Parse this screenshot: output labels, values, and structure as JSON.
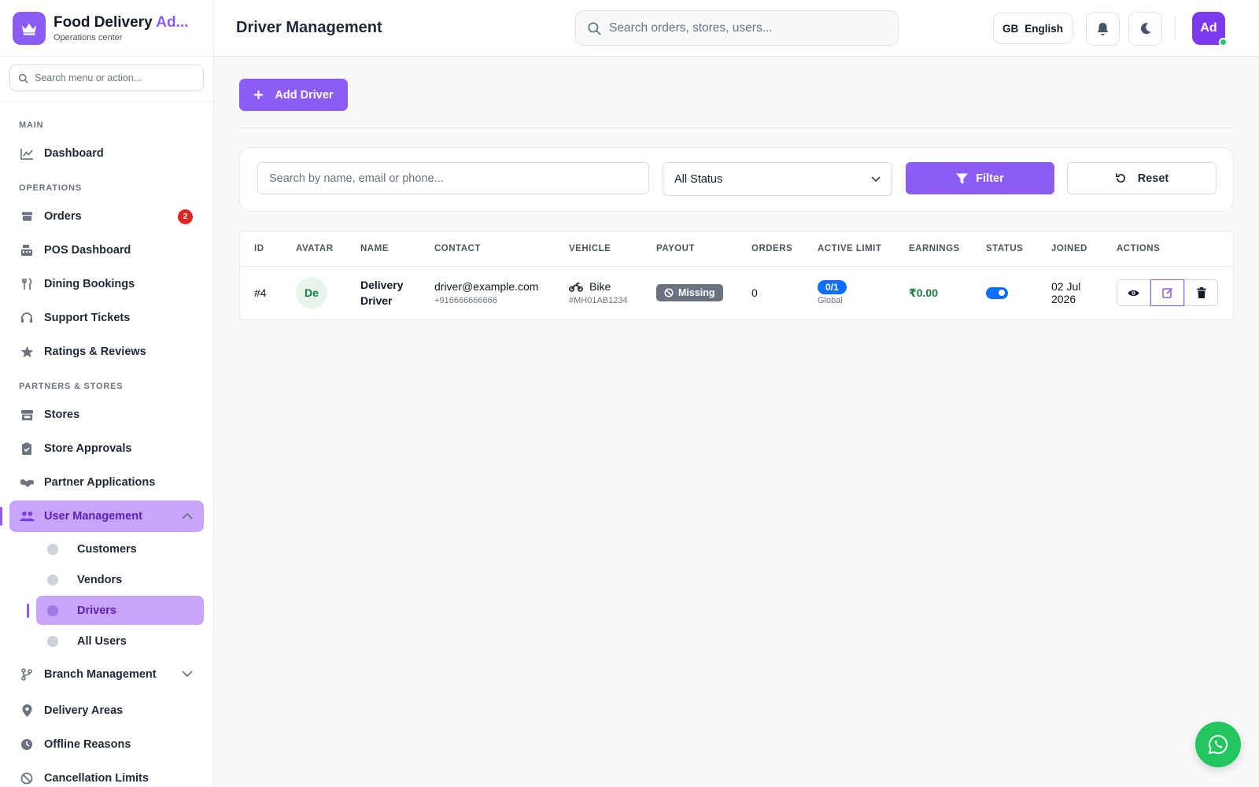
{
  "brand": {
    "title_main": "Food Delivery ",
    "title_accent": "Ad...",
    "subtitle": "Operations center"
  },
  "sidebar": {
    "search_placeholder": "Search menu or action...",
    "sections": {
      "main": "MAIN",
      "operations": "OPERATIONS",
      "partners": "PARTNERS & STORES"
    },
    "items": {
      "dashboard": "Dashboard",
      "orders": "Orders",
      "orders_badge": "2",
      "pos": "POS Dashboard",
      "dining": "Dining Bookings",
      "support": "Support Tickets",
      "ratings": "Ratings & Reviews",
      "stores": "Stores",
      "store_approvals": "Store Approvals",
      "partner_apps": "Partner Applications",
      "user_mgmt": "User Management",
      "customers": "Customers",
      "vendors": "Vendors",
      "drivers": "Drivers",
      "all_users": "All Users",
      "branch_mgmt": "Branch Management",
      "delivery_areas": "Delivery Areas",
      "offline_reasons": "Offline Reasons",
      "cancellation_limits": "Cancellation Limits"
    }
  },
  "header": {
    "title": "Driver Management",
    "search_placeholder": "Search orders, stores, users...",
    "lang_flag": "GB",
    "lang_label": "English",
    "avatar_initials": "Ad"
  },
  "toolbar": {
    "add_label": "Add Driver"
  },
  "filters": {
    "search_placeholder": "Search by name, email or phone...",
    "status_selected": "All Status",
    "filter_label": "Filter",
    "reset_label": "Reset"
  },
  "table": {
    "columns": [
      "ID",
      "AVATAR",
      "NAME",
      "CONTACT",
      "VEHICLE",
      "PAYOUT",
      "ORDERS",
      "ACTIVE LIMIT",
      "EARNINGS",
      "STATUS",
      "JOINED",
      "ACTIONS"
    ],
    "rows": [
      {
        "id": "#4",
        "avatar": "De",
        "name_line1": "Delivery",
        "name_line2": "Driver",
        "email": "driver@example.com",
        "phone": "+916666666666",
        "vehicle": "Bike",
        "plate": "#MH01AB1234",
        "payout": "Missing",
        "orders": "0",
        "limit": "0/1",
        "limit_scope": "Global",
        "earnings": "₹0.00",
        "status_active": true,
        "joined_line1": "02 Jul",
        "joined_line2": "2026"
      }
    ]
  },
  "colors": {
    "accent": "#8b5cf6",
    "danger": "#dc2626",
    "success": "#15803d",
    "primary_blue": "#0d6efd",
    "whatsapp": "#22c55e"
  }
}
